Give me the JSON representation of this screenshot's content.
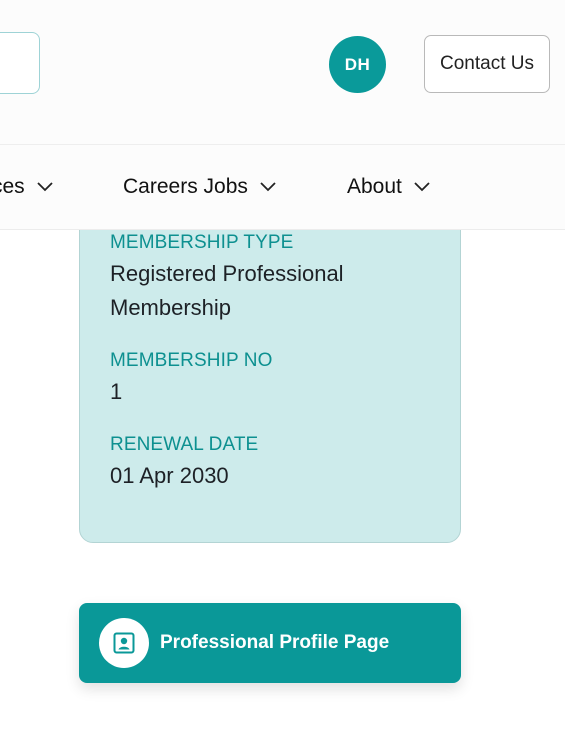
{
  "header": {
    "avatar_initials": "DH",
    "contact_label": "Contact Us",
    "search_placeholder": ""
  },
  "nav": {
    "items": [
      {
        "label": "ces",
        "icon": "chevron-down-icon"
      },
      {
        "label": "Careers Jobs",
        "icon": "chevron-down-icon"
      },
      {
        "label": "About",
        "icon": "chevron-down-icon"
      }
    ]
  },
  "membership": {
    "type_label": "MEMBERSHIP TYPE",
    "type_value": "Registered Professional Membership",
    "no_label": "MEMBERSHIP NO",
    "no_value": "1",
    "renewal_label": "RENEWAL DATE",
    "renewal_value": "01 Apr 2030"
  },
  "profile_button": {
    "label": "Professional Profile Page",
    "icon": "profile-icon"
  },
  "colors": {
    "accent": "#0a9898",
    "card_bg": "#cdebeb",
    "label_text": "#0d9090"
  }
}
